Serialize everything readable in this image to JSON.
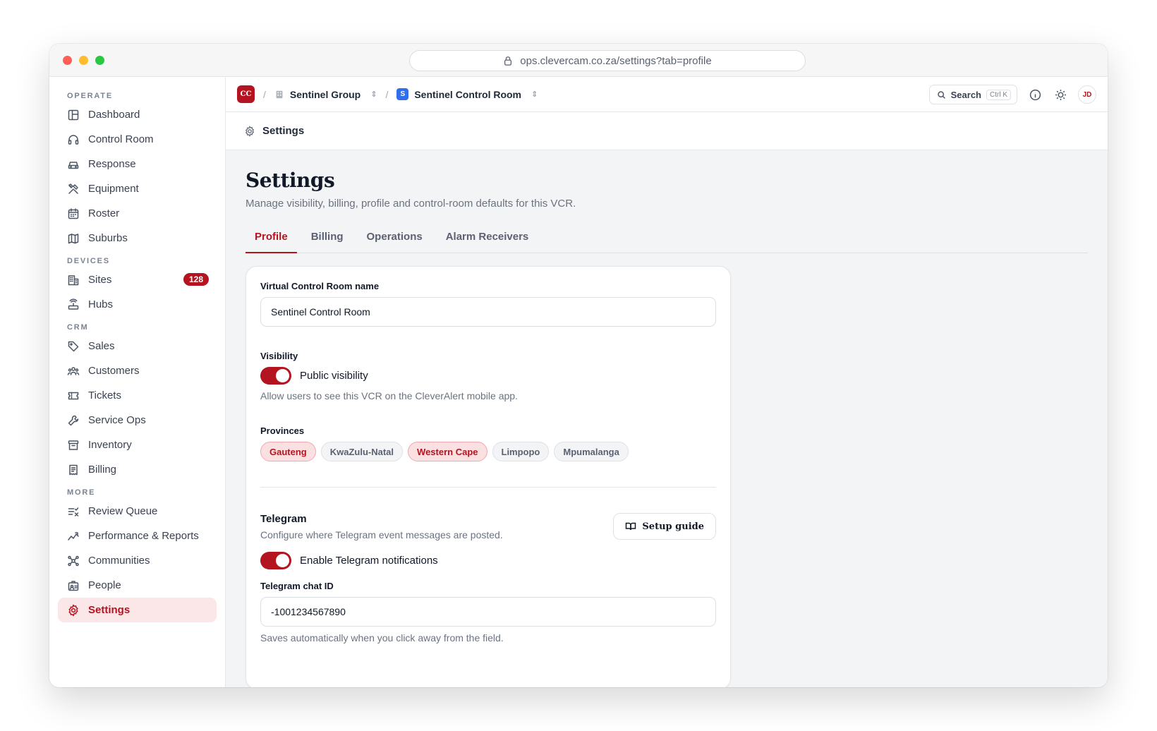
{
  "browser": {
    "url": "ops.clevercam.co.za/settings?tab=profile"
  },
  "sidebar": {
    "sections": [
      {
        "label": "OPERATE",
        "items": [
          {
            "label": "Dashboard",
            "icon": "layout-icon"
          },
          {
            "label": "Control Room",
            "icon": "headset-icon"
          },
          {
            "label": "Response",
            "icon": "car-icon"
          },
          {
            "label": "Equipment",
            "icon": "tools-icon"
          },
          {
            "label": "Roster",
            "icon": "calendar-icon"
          },
          {
            "label": "Suburbs",
            "icon": "map-icon"
          }
        ]
      },
      {
        "label": "DEVICES",
        "items": [
          {
            "label": "Sites",
            "icon": "building-icon",
            "badge": "128"
          },
          {
            "label": "Hubs",
            "icon": "router-icon"
          }
        ]
      },
      {
        "label": "CRM",
        "items": [
          {
            "label": "Sales",
            "icon": "tag-icon"
          },
          {
            "label": "Customers",
            "icon": "users-icon"
          },
          {
            "label": "Tickets",
            "icon": "ticket-icon"
          },
          {
            "label": "Service Ops",
            "icon": "wrench-icon"
          },
          {
            "label": "Inventory",
            "icon": "archive-icon"
          },
          {
            "label": "Billing",
            "icon": "receipt-icon"
          }
        ]
      },
      {
        "label": "MORE",
        "items": [
          {
            "label": "Review Queue",
            "icon": "list-check-icon"
          },
          {
            "label": "Performance & Reports",
            "icon": "trend-icon"
          },
          {
            "label": "Communities",
            "icon": "network-icon"
          },
          {
            "label": "People",
            "icon": "id-badge-icon"
          },
          {
            "label": "Settings",
            "icon": "gear-icon",
            "active": true
          }
        ]
      }
    ]
  },
  "topbar": {
    "logo": "CC",
    "org": "Sentinel Group",
    "room_badge": "S",
    "room": "Sentinel Control Room",
    "search_label": "Search",
    "search_shortcut": "Ctrl K",
    "avatar": "JD"
  },
  "subbar": {
    "title": "Settings"
  },
  "page": {
    "title": "Settings",
    "description": "Manage visibility, billing, profile and control-room defaults for this VCR.",
    "tabs": [
      "Profile",
      "Billing",
      "Operations",
      "Alarm Receivers"
    ],
    "active_tab": "Profile"
  },
  "form": {
    "name_label": "Virtual Control Room name",
    "name_value": "Sentinel Control Room",
    "visibility_label": "Visibility",
    "visibility_toggle_label": "Public visibility",
    "visibility_on": true,
    "visibility_help": "Allow users to see this VCR on the CleverAlert mobile app.",
    "provinces_label": "Provinces",
    "provinces": [
      {
        "name": "Gauteng",
        "selected": true
      },
      {
        "name": "KwaZulu-Natal",
        "selected": false
      },
      {
        "name": "Western Cape",
        "selected": true
      },
      {
        "name": "Limpopo",
        "selected": false
      },
      {
        "name": "Mpumalanga",
        "selected": false
      }
    ],
    "telegram_title": "Telegram",
    "telegram_desc": "Configure where Telegram event messages are posted.",
    "setup_guide": "Setup guide",
    "telegram_toggle_label": "Enable Telegram notifications",
    "telegram_on": true,
    "chat_id_label": "Telegram chat ID",
    "chat_id_value": "-1001234567890",
    "chat_id_help": "Saves automatically when you click away from the field."
  },
  "colors": {
    "accent": "#b4141f",
    "accent_soft": "#fbe6e8",
    "room_badge": "#2f6fed"
  }
}
